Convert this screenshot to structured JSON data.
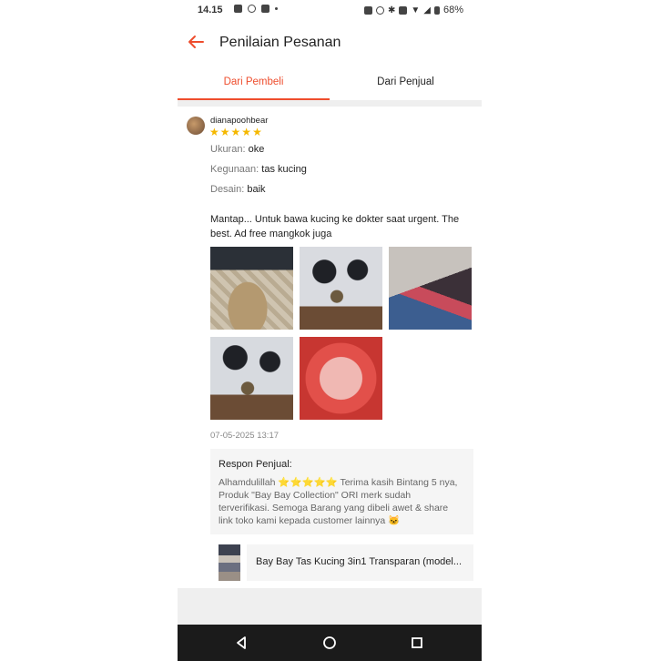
{
  "status_bar": {
    "time": "14.15",
    "battery": "68%"
  },
  "header": {
    "title": "Penilaian Pesanan",
    "back_icon": "back-arrow-icon"
  },
  "tabs": [
    {
      "label": "Dari Pembeli",
      "active": true
    },
    {
      "label": "Dari Penjual",
      "active": false
    }
  ],
  "review": {
    "username": "dianapoohbear",
    "rating": 5,
    "attributes": [
      {
        "key": "Ukuran:",
        "value": "oke"
      },
      {
        "key": "Kegunaan:",
        "value": "tas kucing"
      },
      {
        "key": "Desain:",
        "value": "baik"
      }
    ],
    "text": "Mantap... Untuk bawa kucing ke dokter saat urgent. The best. Ad free mangkok juga",
    "timestamp": "07-05-2025 13:17"
  },
  "seller_response": {
    "title": "Respon Penjual:",
    "text": "Alhamdulillah ⭐⭐⭐⭐⭐ Terima kasih Bintang 5 nya, Produk \"Bay Bay Collection\" ORI merk sudah terverifikasi. Semoga Barang yang dibeli awet & share link toko kami kepada customer lainnya 🐱"
  },
  "product": {
    "name": "Bay Bay Tas Kucing 3in1 Transparan (model..."
  },
  "colors": {
    "accent": "#ee4d2d",
    "star": "#f5b800"
  }
}
